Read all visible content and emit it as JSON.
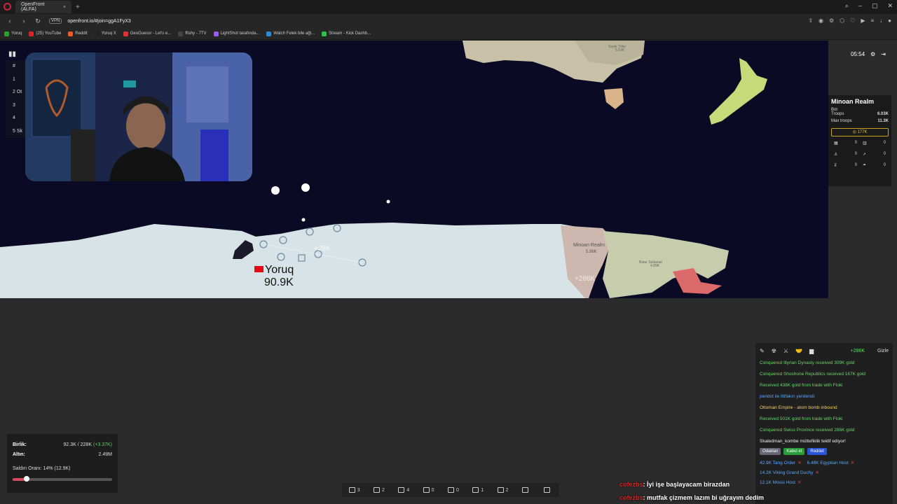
{
  "browser": {
    "tab_title": "OpenFront (ALFA)",
    "url": "openfront.io/#join=ggA1FyX3",
    "vpn_label": "VPN",
    "bookmarks": [
      "Yoruq",
      "(25) YouTube",
      "Reddit",
      "Yoruq X",
      "GeoGuessr - Let's e...",
      "ffishy - 7TV",
      "LightShot tarafında...",
      "Watch Felek bile ağl...",
      "Stream - Kick Dashb..."
    ],
    "bookmark_colors": [
      "#2aa12a",
      "#e02020",
      "#ff5722",
      "#222222",
      "#e0303a",
      "#444444",
      "#9b59ff",
      "#2a8bd8",
      "#29c24a"
    ]
  },
  "leaderboard": {
    "icon": "bar-chart-icon",
    "rows": [
      "#",
      "1",
      "2  Ot",
      "3",
      "4",
      "5  Sk"
    ]
  },
  "game": {
    "timer": "05:54",
    "player_label_name": "Yoruq",
    "player_label_troops": "90.9K",
    "floating_text_1": "+28K",
    "floating_text_2": "+286K",
    "region_labels": [
      {
        "name": "Minoan Realm",
        "value": "5.96K"
      },
      {
        "name": "Batur Sultanati",
        "value": "4.89K"
      },
      {
        "name": "Sepik Tribe",
        "value": "5.53K"
      }
    ]
  },
  "player_panel": {
    "name": "Minoan Realm",
    "type": "Bot",
    "troops_label": "Troops",
    "troops_value": "6.03K",
    "max_troops_label": "Max troops",
    "max_troops_value": "11.3K",
    "gold": "177K",
    "buildings": [
      "0",
      "0",
      "0",
      "0",
      "0",
      "0"
    ]
  },
  "events": {
    "gain": "+286K",
    "hide_label": "Gizle",
    "items": [
      {
        "text": "Conquered Illyrian Dynasty received 309K gold",
        "color": "green"
      },
      {
        "text": "Conquered Shoshone Republics received 167K gold",
        "color": "green"
      },
      {
        "text": "Received 438K gold from trade with Floki",
        "color": "green"
      },
      {
        "text": "peridot ile ittifakın yenilendi",
        "color": "blue"
      },
      {
        "text": "Ottoman Empire - atom bomb inbound",
        "color": "yellow"
      },
      {
        "text": "Received 501K gold from trade with Floki",
        "color": "green"
      },
      {
        "text": "Conquered Swiss Province received 286K gold",
        "color": "green"
      },
      {
        "text": "Skaledman_kombe müttefiklik teklif ediyor!",
        "color": "white"
      }
    ],
    "focus_label": "Odaklan",
    "accept_label": "Kabul et",
    "reject_label": "Reddet",
    "attacks": [
      "42.9K Tang Order",
      "6.48K Egyptian Host",
      "14.2K Viking Grand Duchy",
      "12.1K Mossi Host"
    ]
  },
  "stats": {
    "troops_label": "Birlik:",
    "troops_value": "92.3K / 228K",
    "troops_rate": "(+3.37K)",
    "gold_label": "Altın:",
    "gold_value": "2.49M",
    "attack_rate_label": "Saldırı Oranı: 14% (12.9K)",
    "attack_ratio": 0.14
  },
  "buildbar": {
    "items": [
      "3",
      "2",
      "4",
      "0",
      "0",
      "1",
      "2",
      "",
      ""
    ]
  },
  "chat": [
    {
      "user": "cofezbs",
      "message": ": İyi işe başlayacam birazdan"
    },
    {
      "user": "cofezbs",
      "message": ": mutfak çizmem lazım bi uğrayım dedim"
    }
  ]
}
